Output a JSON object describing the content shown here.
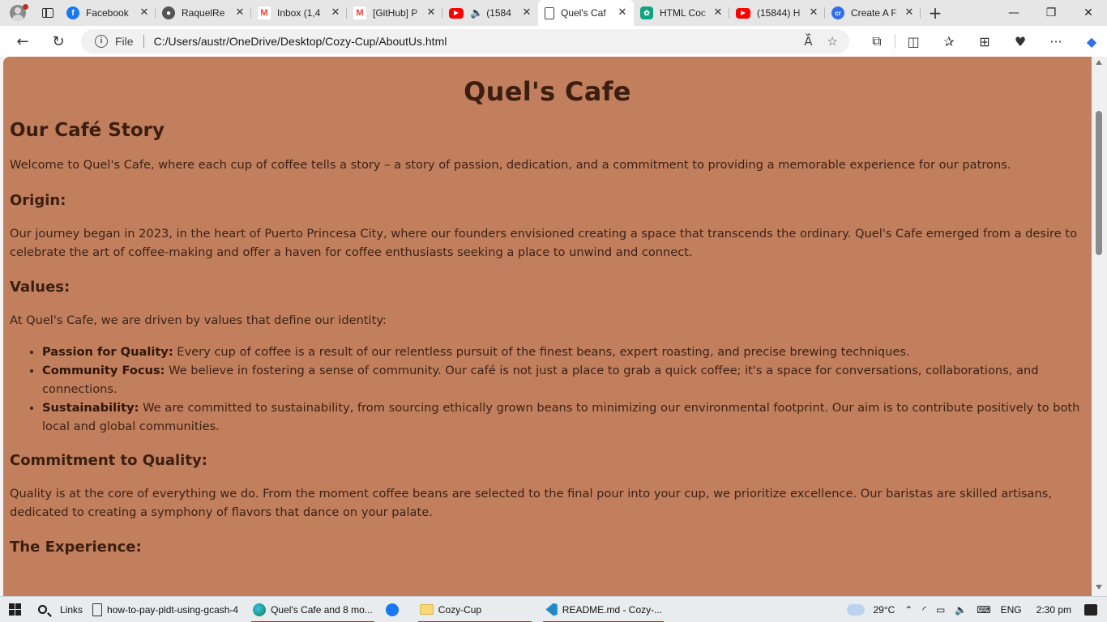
{
  "browser": {
    "tabs": [
      {
        "title": "Facebook",
        "icon": "facebook-icon"
      },
      {
        "title": "RaquelRe",
        "icon": "github-icon"
      },
      {
        "title": "Inbox (1,4",
        "icon": "gmail-icon"
      },
      {
        "title": "[GitHub] P",
        "icon": "gmail-icon"
      },
      {
        "title": "(1584",
        "icon": "youtube-icon",
        "playing_audio": true
      },
      {
        "title": "Quel's Caf",
        "icon": "document-icon",
        "active": true
      },
      {
        "title": "HTML Coc",
        "icon": "chatgpt-icon"
      },
      {
        "title": "(15844) H",
        "icon": "youtube-icon"
      },
      {
        "title": "Create A F",
        "icon": "creator-icon"
      }
    ],
    "address": {
      "scheme_label": "File",
      "url": "C:/Users/austr/OneDrive/Desktop/Cozy-Cup/AboutUs.html"
    }
  },
  "page": {
    "site_title": "Quel's Cafe",
    "story_heading": "Our Café Story",
    "intro": "Welcome to Quel's Cafe, where each cup of coffee tells a story – a story of passion, dedication, and a commitment to providing a memorable experience for our patrons.",
    "origin": {
      "heading": "Origin:",
      "text": "Our journey began in 2023, in the heart of Puerto Princesa City, where our founders envisioned creating a space that transcends the ordinary. Quel's Cafe emerged from a desire to celebrate the art of coffee-making and offer a haven for coffee enthusiasts seeking a place to unwind and connect."
    },
    "values": {
      "heading": "Values:",
      "intro": "At Quel's Cafe, we are driven by values that define our identity:",
      "items": [
        {
          "title": "Passion for Quality:",
          "text": " Every cup of coffee is a result of our relentless pursuit of the finest beans, expert roasting, and precise brewing techniques."
        },
        {
          "title": "Community Focus:",
          "text": " We believe in fostering a sense of community. Our café is not just a place to grab a quick coffee; it's a space for conversations, collaborations, and connections."
        },
        {
          "title": "Sustainability:",
          "text": " We are committed to sustainability, from sourcing ethically grown beans to minimizing our environmental footprint. Our aim is to contribute positively to both local and global communities."
        }
      ]
    },
    "commitment": {
      "heading": "Commitment to Quality:",
      "text": "Quality is at the core of everything we do. From the moment coffee beans are selected to the final pour into your cup, we prioritize excellence. Our baristas are skilled artisans, dedicated to creating a symphony of flavors that dance on your palate."
    },
    "experience": {
      "heading": "The Experience:"
    },
    "colors": {
      "background": "#c17f5d",
      "text": "#3b1f12"
    }
  },
  "taskbar": {
    "links_label": "Links",
    "items": [
      {
        "label": "how-to-pay-pldt-using-gcash-4",
        "icon": "html-file-icon"
      },
      {
        "label": "Quel's Cafe and 8 mo...",
        "icon": "edge-icon",
        "active": true
      },
      {
        "label": "",
        "icon": "facebook-icon"
      },
      {
        "label": "Cozy-Cup",
        "icon": "folder-icon",
        "active": true
      },
      {
        "label": "README.md - Cozy-...",
        "icon": "vscode-icon",
        "active": true
      }
    ],
    "weather": "29°C",
    "language": "ENG",
    "time": "2:30 pm"
  }
}
